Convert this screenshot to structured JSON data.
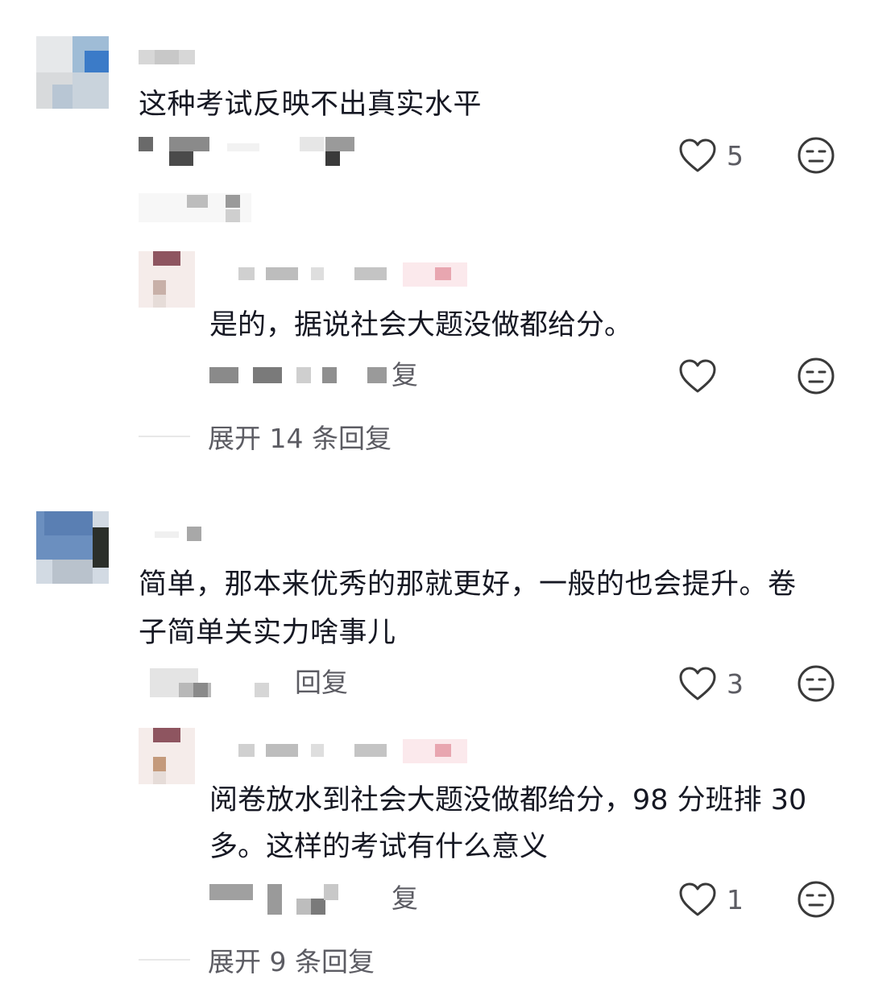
{
  "comments": [
    {
      "text": "这种考试反映不出真实水平",
      "likes": "5",
      "reply": {
        "text": "是的，据说社会大题没做都给分。",
        "reply_label": "复",
        "likes": ""
      },
      "expand_label": "展开 14 条回复"
    },
    {
      "text_line1": "简单，那本来优秀的那就更好，一般的也会提升。卷",
      "text_line2": "子简单关实力啥事儿",
      "reply_label": "回复",
      "likes": "3",
      "reply": {
        "text_line1": "阅卷放水到社会大题没做都给分，98 分班排 30",
        "text_line2": "多。这样的考试有什么意义",
        "reply_label": "复",
        "likes": "1"
      },
      "expand_label": "展开 9 条回复"
    }
  ],
  "icons": {
    "like": "heart-outline-icon",
    "dislike": "neutral-face-icon"
  },
  "colors": {
    "text": "#161823",
    "meta": "#5c5c63",
    "icon": "#3a3a3a",
    "divider": "#e8e8e8"
  }
}
